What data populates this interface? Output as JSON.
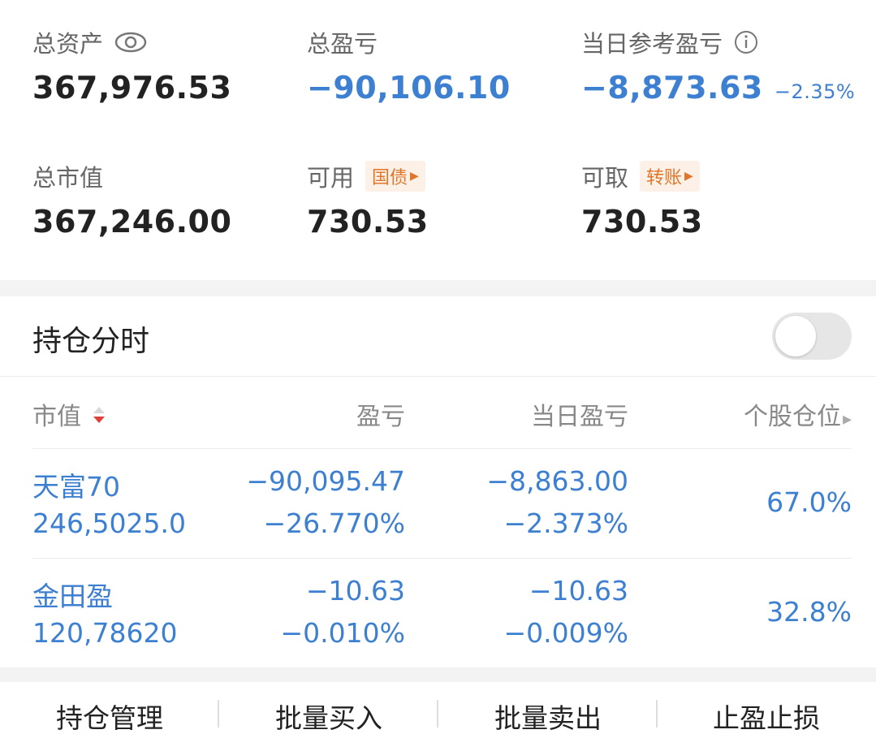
{
  "summary": {
    "total_assets": {
      "label": "总资产",
      "value": "367,976.53"
    },
    "total_pnl": {
      "label": "总盈亏",
      "value": "−90,106.10"
    },
    "day_pnl": {
      "label": "当日参考盈亏",
      "value": "−8,873.63",
      "pct": "−2.35%"
    },
    "market_value": {
      "label": "总市值",
      "value": "367,246.00"
    },
    "available": {
      "label": "可用",
      "tag": "国债",
      "value": "730.53"
    },
    "withdrawable": {
      "label": "可取",
      "tag": "转账",
      "value": "730.53"
    }
  },
  "holdings": {
    "title": "持仓分时",
    "toggle_on": false,
    "columns": {
      "market_value": "市值",
      "pnl": "盈亏",
      "day_pnl": "当日盈亏",
      "position": "个股仓位"
    },
    "rows": [
      {
        "name": "天富70",
        "market_value": "246,5025.0",
        "pnl": "−90,095.47",
        "pnl_pct": "−26.770%",
        "day_pnl": "−8,863.00",
        "day_pnl_pct": "−2.373%",
        "position": "67.0%"
      },
      {
        "name": "金田盈",
        "market_value": "120,78620",
        "pnl": "−10.63",
        "pnl_pct": "−0.010%",
        "day_pnl": "−10.63",
        "day_pnl_pct": "−0.009%",
        "position": "32.8%"
      }
    ]
  },
  "bottom_actions": [
    "持仓管理",
    "批量买入",
    "批量卖出",
    "止盈止损"
  ],
  "colors": {
    "loss_blue": "#3d7fd0",
    "tag_orange": "#e0762b",
    "tag_bg": "#fdf0e6"
  }
}
